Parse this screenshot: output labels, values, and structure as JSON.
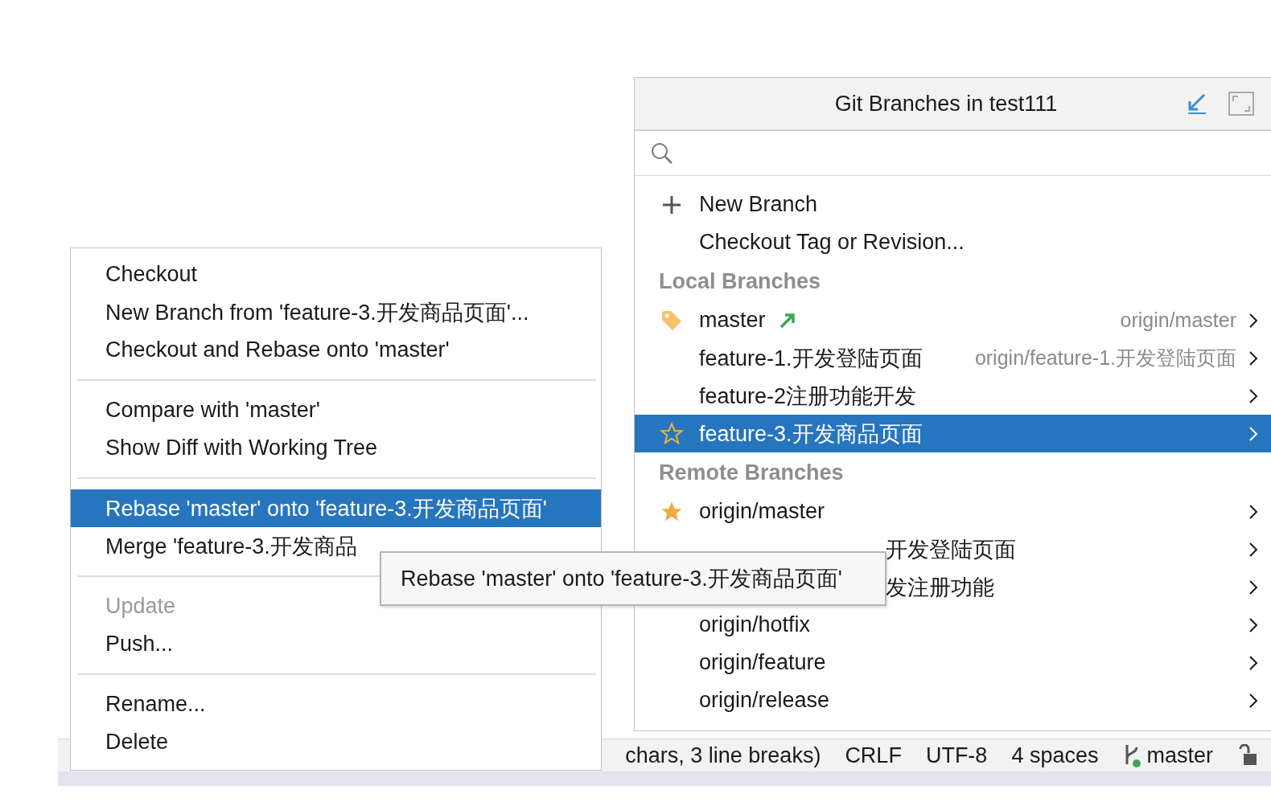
{
  "branch_popup": {
    "title": "Git Branches in test111",
    "actions": [
      {
        "label": "New Branch",
        "kind": "new"
      },
      {
        "label": "Checkout Tag or Revision...",
        "kind": "plain"
      }
    ],
    "sections": [
      {
        "heading": "Local Branches",
        "branches": [
          {
            "name": "master",
            "kind": "tag",
            "outgoing": true,
            "tracking": "origin/master",
            "selected": false,
            "partial": false
          },
          {
            "name": "feature-1.开发登陆页面",
            "kind": "none",
            "outgoing": false,
            "tracking": "origin/feature-1.开发登陆页面",
            "selected": false,
            "partial": false
          },
          {
            "name": "feature-2注册功能开发",
            "kind": "none",
            "outgoing": false,
            "selected": false,
            "partial": false
          },
          {
            "name": "feature-3.开发商品页面",
            "kind": "star-outline",
            "outgoing": false,
            "selected": true,
            "partial": false
          }
        ]
      },
      {
        "heading": "Remote Branches",
        "branches": [
          {
            "name": "origin/master",
            "kind": "star",
            "outgoing": false,
            "selected": false,
            "partial": false
          },
          {
            "name": "开发登陆页面",
            "kind": "none",
            "outgoing": false,
            "selected": false,
            "partial": true
          },
          {
            "name": "发注册功能",
            "kind": "none",
            "outgoing": false,
            "selected": false,
            "partial": true
          },
          {
            "name": "origin/hotfix",
            "kind": "none",
            "outgoing": false,
            "selected": false,
            "partial": false
          },
          {
            "name": "origin/feature",
            "kind": "none",
            "outgoing": false,
            "selected": false,
            "partial": false
          },
          {
            "name": "origin/release",
            "kind": "none",
            "outgoing": false,
            "selected": false,
            "partial": false
          }
        ]
      }
    ]
  },
  "context_menu": {
    "groups": [
      [
        {
          "label": "Checkout",
          "selected": false,
          "disabled": false
        },
        {
          "label": "New Branch from 'feature-3.开发商品页面'...",
          "selected": false,
          "disabled": false
        },
        {
          "label": "Checkout and Rebase onto 'master'",
          "selected": false,
          "disabled": false
        }
      ],
      [
        {
          "label": "Compare with 'master'",
          "selected": false,
          "disabled": false
        },
        {
          "label": "Show Diff with Working Tree",
          "selected": false,
          "disabled": false
        }
      ],
      [
        {
          "label": "Rebase 'master' onto 'feature-3.开发商品页面'",
          "selected": true,
          "disabled": false
        },
        {
          "label": "Merge 'feature-3.开发商品",
          "selected": false,
          "disabled": false
        }
      ],
      [
        {
          "label": "Update",
          "selected": false,
          "disabled": true
        },
        {
          "label": "Push...",
          "selected": false,
          "disabled": false
        }
      ],
      [
        {
          "label": "Rename...",
          "selected": false,
          "disabled": false
        },
        {
          "label": "Delete",
          "selected": false,
          "disabled": false
        }
      ]
    ]
  },
  "tooltip": {
    "text": "Rebase 'master' onto 'feature-3.开发商品页面'"
  },
  "status_bar": {
    "items": [
      "chars, 3 line breaks)",
      "CRLF",
      "UTF-8",
      "4 spaces"
    ],
    "branch": "master"
  }
}
